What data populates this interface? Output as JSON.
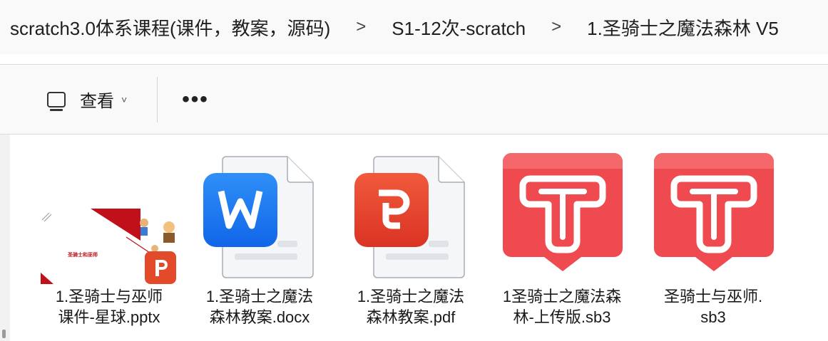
{
  "breadcrumb": {
    "items": [
      "scratch3.0体系课程(课件，教案，源码)",
      "S1-12次-scratch",
      "1.圣骑士之魔法森林 V5"
    ],
    "separator": ">"
  },
  "toolbar": {
    "view_label": "查看",
    "more_label": "•••"
  },
  "ppt_slide_text": "圣骑士和巫师",
  "files": [
    {
      "name_line1": "1.圣骑士与巫师",
      "name_line2": "课件-星球.pptx",
      "icon": "powerpoint-thumbnail"
    },
    {
      "name_line1": "1.圣骑士之魔法",
      "name_line2": "森林教案.docx",
      "icon": "wps-writer-icon"
    },
    {
      "name_line1": "1.圣骑士之魔法",
      "name_line2": "森林教案.pdf",
      "icon": "wps-pdf-icon"
    },
    {
      "name_line1": "1圣骑士之魔法森",
      "name_line2": "林-上传版.sb3",
      "icon": "scratch-file-icon"
    },
    {
      "name_line1": "圣骑士与巫师.",
      "name_line2": "sb3",
      "icon": "scratch-file-icon"
    }
  ],
  "colors": {
    "wps_writer_blue": "#1a7cf0",
    "wps_pdf_red": "#e8452f",
    "scratch_red": "#ef4a4f"
  }
}
